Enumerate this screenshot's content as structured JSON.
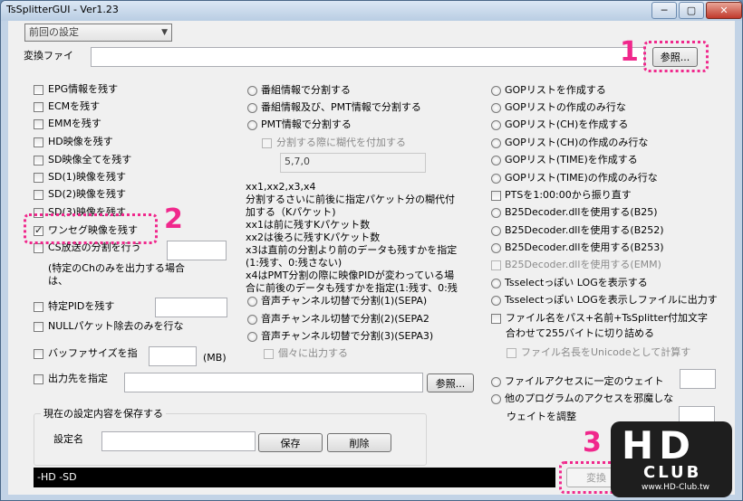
{
  "window": {
    "title": "TsSplitterGUI    -    Ver1.23"
  },
  "top": {
    "preset_select": "前回の設定",
    "file_label": "変換ファイ",
    "browse_button": "参照..."
  },
  "annotations": {
    "one": "1",
    "two": "2",
    "three": "3"
  },
  "left_col": [
    {
      "label": "EPG情報を残す",
      "checked": false
    },
    {
      "label": "ECMを残す",
      "checked": false
    },
    {
      "label": "EMMを残す",
      "checked": false
    },
    {
      "label": "HD映像を残す",
      "checked": false
    },
    {
      "label": "SD映像全てを残す",
      "checked": false
    },
    {
      "label": "SD(1)映像を残す",
      "checked": false
    },
    {
      "label": "SD(2)映像を残す",
      "checked": false
    },
    {
      "label": "SD(3)映像を残す",
      "checked": false
    },
    {
      "label": "ワンセグ映像を残す",
      "checked": true
    },
    {
      "label": "CS放送の分割を行う",
      "checked": false
    }
  ],
  "left_note": {
    "line1": "(特定のChのみを出力する場合",
    "line2": "は、"
  },
  "left_extra": {
    "specific_pid": "特定PIDを残す",
    "null_packet": "NULLパケット除去のみを行な",
    "buffer_size": "バッファサイズを指",
    "buffer_unit": "(MB)",
    "output_dest": "出力先を指定",
    "output_browse": "参照..."
  },
  "mid_col": {
    "radios": [
      "番組情報で分割する",
      "番組情報及び、PMT情報で分割する",
      "PMT情報で分割する"
    ],
    "sub_check": "分割する際に糊代を付加する",
    "sub_input": "5,7,0",
    "help_lines": [
      "xx1,xx2,x3,x4",
      "分割するさいに前後に指定パケット分の糊代付",
      "加する（Kパケット)",
      "xx1は前に残すKパケット数",
      "xx2は後ろに残すKパケット数",
      "x3は直前の分割より前のデータも残すかを指定",
      "(1:残す、0:残さない)",
      "x4はPMT分割の際に映像PIDが変わっている場",
      "合に前後のデータも残すかを指定(1:残す、0:残"
    ],
    "audio_radios": [
      "音声チャンネル切替で分割(1)(SEPA)",
      "音声チャンネル切替で分割(2)(SEPA2",
      "音声チャンネル切替で分割(3)(SEPA3)"
    ],
    "audio_sub": "個々に出力する"
  },
  "right_col": {
    "radios": [
      "GOPリストを作成する",
      "GOPリストの作成のみ行な",
      "GOPリスト(CH)を作成する",
      "GOPリスト(CH)の作成のみ行な",
      "GOPリスト(TIME)を作成する",
      "GOPリスト(TIME)の作成のみ行な"
    ],
    "pts": "PTSを1:00:00から振り直す",
    "b25": [
      "B25Decoder.dllを使用する(B25)",
      "B25Decoder.dllを使用する(B252)",
      "B25Decoder.dllを使用する(B253)"
    ],
    "b25_emm": "B25Decoder.dllを使用する(EMM)",
    "tsselect1": "Tsselectっぽい LOGを表示する",
    "tsselect2": "Tsselectっぽい LOGを表示しファイルに出力す",
    "filename_line1": "ファイル名をパス+名前+TsSplitter付加文字",
    "filename_line2": "合わせて255バイトに切り詰める",
    "unicode": "ファイル名長をUnicodeとして計算す",
    "access_wait": "ファイルアクセスに一定のウェイト",
    "other_prog": "他のプログラムのアクセスを邪魔しな",
    "wait_adjust": "ウェイトを調整"
  },
  "save_group": {
    "legend": "現在の設定内容を保存する",
    "name_label": "設定名",
    "save_button": "保存",
    "delete_button": "削除"
  },
  "status": {
    "text": "-HD -SD"
  },
  "convert_button": "変換",
  "watermark": {
    "logo": "HD",
    "sub": "CLUB",
    "url": "www.HD-Club.tw"
  }
}
